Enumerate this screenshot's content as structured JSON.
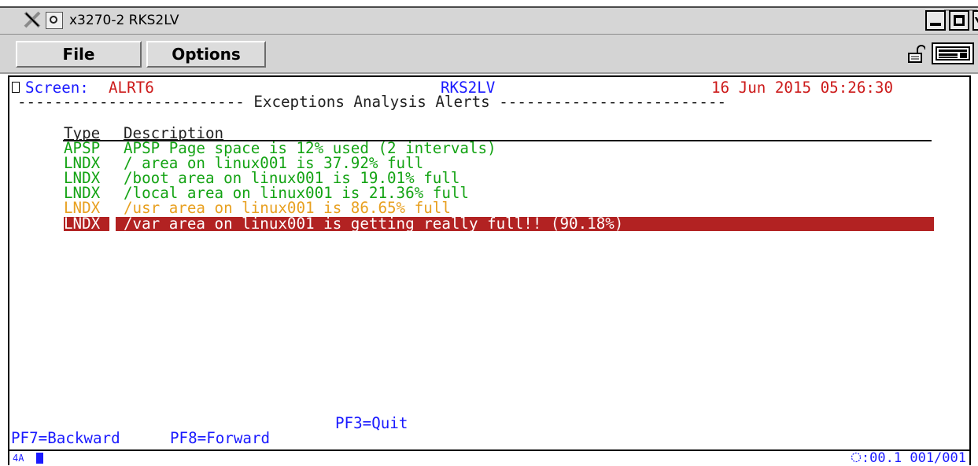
{
  "window": {
    "title": "x3270-2 RKS2LV"
  },
  "menu": {
    "file": "File",
    "options": "Options"
  },
  "screen": {
    "label": "Screen:",
    "name": "ALRT6",
    "system": "RKS2LV",
    "datetime": "16 Jun 2015 05:26:30",
    "banner": "------------------------- Exceptions Analysis Alerts -------------------------",
    "col_type": "Type",
    "col_description": "Description",
    "alerts": [
      {
        "type": "APSP",
        "description": "APSP Page space is 12% used (2 intervals)",
        "severity": "normal",
        "color": "#13a313"
      },
      {
        "type": "LNDX",
        "description": "/ area on linux001 is 37.92% full",
        "severity": "normal",
        "color": "#13a313"
      },
      {
        "type": "LNDX",
        "description": "/boot area on linux001 is 19.01% full",
        "severity": "normal",
        "color": "#13a313"
      },
      {
        "type": "LNDX",
        "description": "/local area on linux001 is 21.36% full",
        "severity": "normal",
        "color": "#13a313"
      },
      {
        "type": "LNDX",
        "description": "/usr area on linux001 is 86.65% full",
        "severity": "warning",
        "color": "#e8a020"
      },
      {
        "type": "LNDX",
        "description": "/var area on linux001 is getting really full!! (90.18%)",
        "severity": "critical",
        "color": "#b22222"
      }
    ],
    "pf3": "PF3=Quit",
    "pf7": "PF7=Backward",
    "pf8": "PF8=Forward"
  },
  "status": {
    "oia_left": "4A",
    "timer": ":00.1",
    "position": "001/001"
  },
  "colors": {
    "field_blue": "#1a1aff",
    "ok_green": "#13a313",
    "warn_orange": "#e8a020",
    "critical_red": "#b22222",
    "header_red": "#cc1a1a"
  },
  "icons": {
    "app": "x-icon",
    "menu": "circle-menu-icon",
    "lock": "lock-icon",
    "keyboard": "keyboard-icon"
  }
}
